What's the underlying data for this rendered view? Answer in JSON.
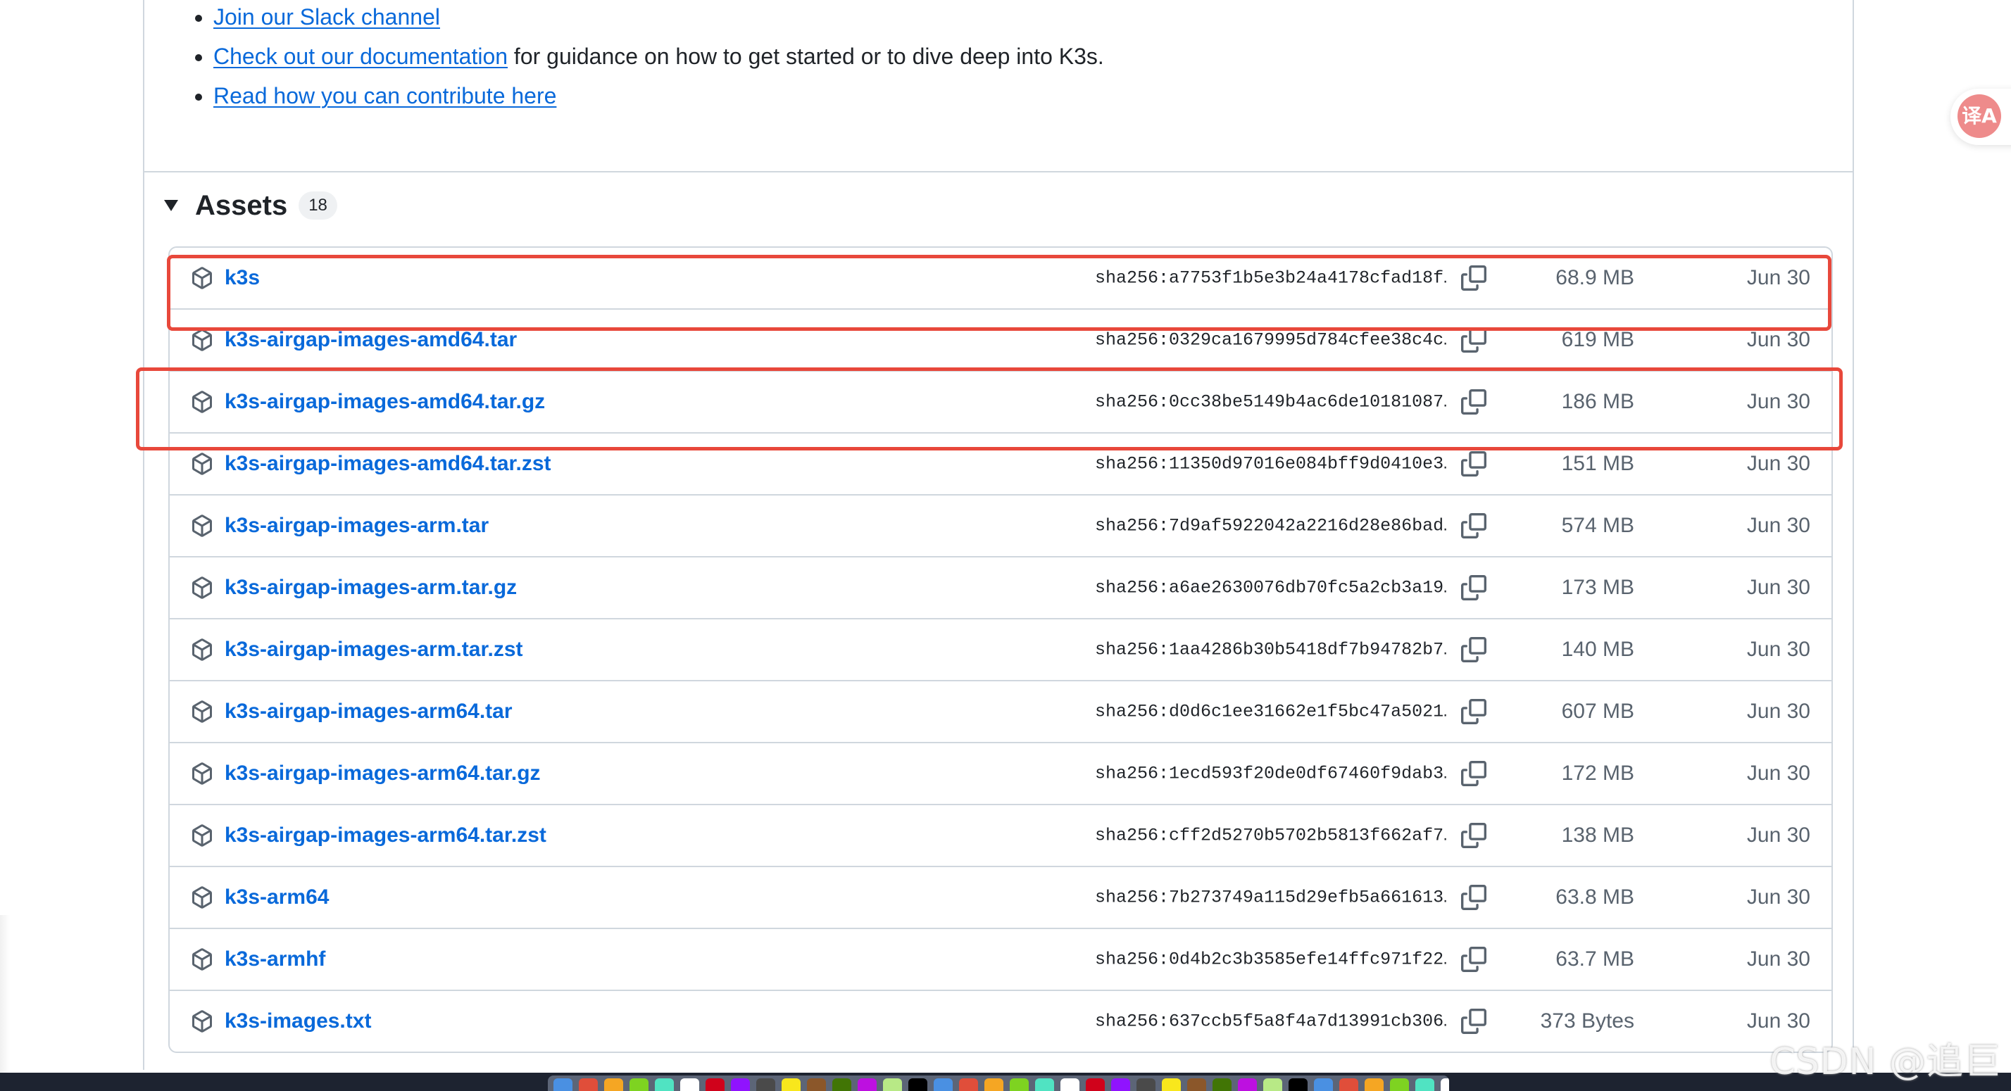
{
  "release_notes": {
    "links": [
      {
        "link_text": "Join our Slack channel",
        "suffix": ""
      },
      {
        "link_text": "Check out our documentation",
        "suffix": " for guidance on how to get started or to dive deep into K3s."
      },
      {
        "link_text": "Read how you can contribute here",
        "suffix": ""
      }
    ]
  },
  "assets": {
    "title": "Assets",
    "count": "18",
    "items": [
      {
        "name": "k3s",
        "sha": "sha256:a7753f1b5e3b24a4178cfad18f…",
        "size": "68.9 MB",
        "date": "Jun 30"
      },
      {
        "name": "k3s-airgap-images-amd64.tar",
        "sha": "sha256:0329ca1679995d784cfee38c4c…",
        "size": "619 MB",
        "date": "Jun 30"
      },
      {
        "name": "k3s-airgap-images-amd64.tar.gz",
        "sha": "sha256:0cc38be5149b4ac6de10181087…",
        "size": "186 MB",
        "date": "Jun 30"
      },
      {
        "name": "k3s-airgap-images-amd64.tar.zst",
        "sha": "sha256:11350d97016e084bff9d0410e3…",
        "size": "151 MB",
        "date": "Jun 30"
      },
      {
        "name": "k3s-airgap-images-arm.tar",
        "sha": "sha256:7d9af5922042a2216d28e86bad…",
        "size": "574 MB",
        "date": "Jun 30"
      },
      {
        "name": "k3s-airgap-images-arm.tar.gz",
        "sha": "sha256:a6ae2630076db70fc5a2cb3a19…",
        "size": "173 MB",
        "date": "Jun 30"
      },
      {
        "name": "k3s-airgap-images-arm.tar.zst",
        "sha": "sha256:1aa4286b30b5418df7b94782b7…",
        "size": "140 MB",
        "date": "Jun 30"
      },
      {
        "name": "k3s-airgap-images-arm64.tar",
        "sha": "sha256:d0d6c1ee31662e1f5bc47a5021…",
        "size": "607 MB",
        "date": "Jun 30"
      },
      {
        "name": "k3s-airgap-images-arm64.tar.gz",
        "sha": "sha256:1ecd593f20de0df67460f9dab3…",
        "size": "172 MB",
        "date": "Jun 30"
      },
      {
        "name": "k3s-airgap-images-arm64.tar.zst",
        "sha": "sha256:cff2d5270b5702b5813f662af7…",
        "size": "138 MB",
        "date": "Jun 30"
      },
      {
        "name": "k3s-arm64",
        "sha": "sha256:7b273749a115d29efb5a661613…",
        "size": "63.8 MB",
        "date": "Jun 30"
      },
      {
        "name": "k3s-armhf",
        "sha": "sha256:0d4b2c3b3585efe14ffc971f22…",
        "size": "63.7 MB",
        "date": "Jun 30"
      },
      {
        "name": "k3s-images.txt",
        "sha": "sha256:637ccb5f5a8f4a7d13991cb306…",
        "size": "373 Bytes",
        "date": "Jun 30"
      }
    ]
  },
  "translate_button": {
    "glyph": "译A"
  },
  "watermark": "CSDN @追巨",
  "colors": {
    "link": "#0969da",
    "highlight": "#e8483b",
    "border": "#d0d7de",
    "muted": "#59636e"
  },
  "icons": {
    "asset": "package-icon",
    "copy": "copy-icon",
    "caret": "triangle-down-icon"
  },
  "dock_apps": [
    "#4a90e2",
    "#e04e3a",
    "#f5a623",
    "#7ed321",
    "#50e3c2",
    "#ffffff",
    "#d0021b",
    "#9013fe",
    "#4a4a4a",
    "#f8e71c",
    "#8b572a",
    "#417505",
    "#bd10e0",
    "#b8e986",
    "#000000",
    "#4a90e2",
    "#e04e3a",
    "#f5a623",
    "#7ed321",
    "#50e3c2",
    "#ffffff",
    "#d0021b",
    "#9013fe",
    "#4a4a4a",
    "#f8e71c",
    "#8b572a",
    "#417505",
    "#bd10e0",
    "#b8e986",
    "#000000",
    "#4a90e2",
    "#e04e3a",
    "#f5a623",
    "#7ed321",
    "#50e3c2",
    "#ffffff",
    "#d0021b",
    "#9013fe"
  ]
}
